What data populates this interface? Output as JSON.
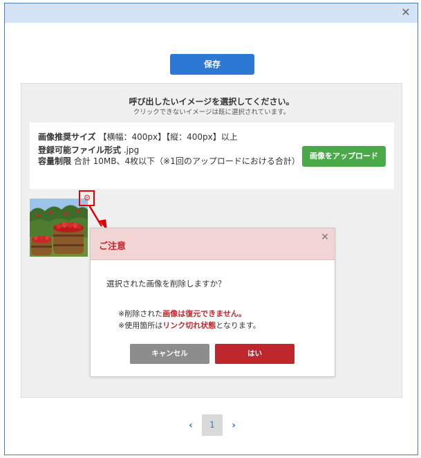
{
  "modal": {
    "close_icon": "close-icon",
    "save_label": "保存"
  },
  "panel": {
    "title": "呼び出したいイメージを選択してください。",
    "subtitle": "クリックできないイメージは既に選択されています。",
    "spec": {
      "size_label": "画像推奨サイズ",
      "size_value": "【横幅：400px】【縦：400px】以上",
      "format_label": "登録可能ファイル形式",
      "format_value": ".jpg",
      "capacity_label": "容量制限",
      "capacity_value": "合計 10MB、4枚以下（※1回のアップロードにおける合計）"
    },
    "upload_label": "画像をアップロード",
    "thumbnail_icon": "apple-basket-photo",
    "delete_icon": "gear-icon"
  },
  "dialog": {
    "title": "ご注意",
    "question": "選択された画像を削除しますか？",
    "warning1_prefix": "※削除された",
    "warning1_strong": "画像は復元できません。",
    "warning2_prefix": "※使用箇所は",
    "warning2_strong": "リンク切れ状態",
    "warning2_suffix": "となります。",
    "cancel_label": "キャンセル",
    "yes_label": "はい"
  },
  "pagination": {
    "prev_icon": "chevron-left-icon",
    "current_page": "1",
    "next_icon": "chevron-right-icon"
  },
  "colors": {
    "primary": "#2d78d3",
    "success": "#4aaa4a",
    "danger": "#c0272d",
    "header": "#d4e3f5"
  }
}
